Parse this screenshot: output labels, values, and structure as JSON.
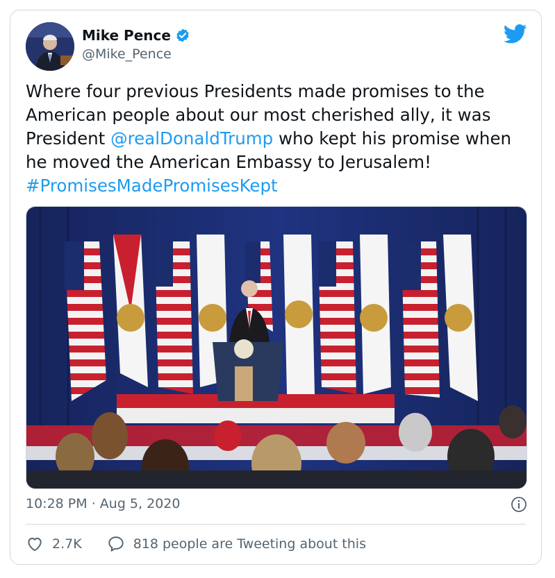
{
  "author": {
    "name": "Mike Pence",
    "handle": "@Mike_Pence",
    "verified": true
  },
  "tweet": {
    "text_before_mention": "Where four previous Presidents made promises to the American people about our most cherished ally, it was President ",
    "mention": "@realDonaldTrump",
    "text_after_mention": " who kept his promise when he moved the American Embassy to Jerusalem! ",
    "hashtag": "#PromisesMadePromisesKept"
  },
  "meta": {
    "time": "10:28 PM",
    "separator": "·",
    "date": "Aug 5, 2020"
  },
  "stats": {
    "likes": "2.7K",
    "tweeting_text": "818 people are Tweeting about this"
  },
  "colors": {
    "link": "#1d9bf0",
    "verified": "#1d9bf0",
    "secondary_text": "#536471",
    "border": "#cfd9de"
  },
  "icons": {
    "logo": "twitter-bird-icon",
    "verified": "verified-badge-icon",
    "info": "info-icon",
    "like": "heart-icon",
    "reply": "speech-bubble-icon"
  }
}
